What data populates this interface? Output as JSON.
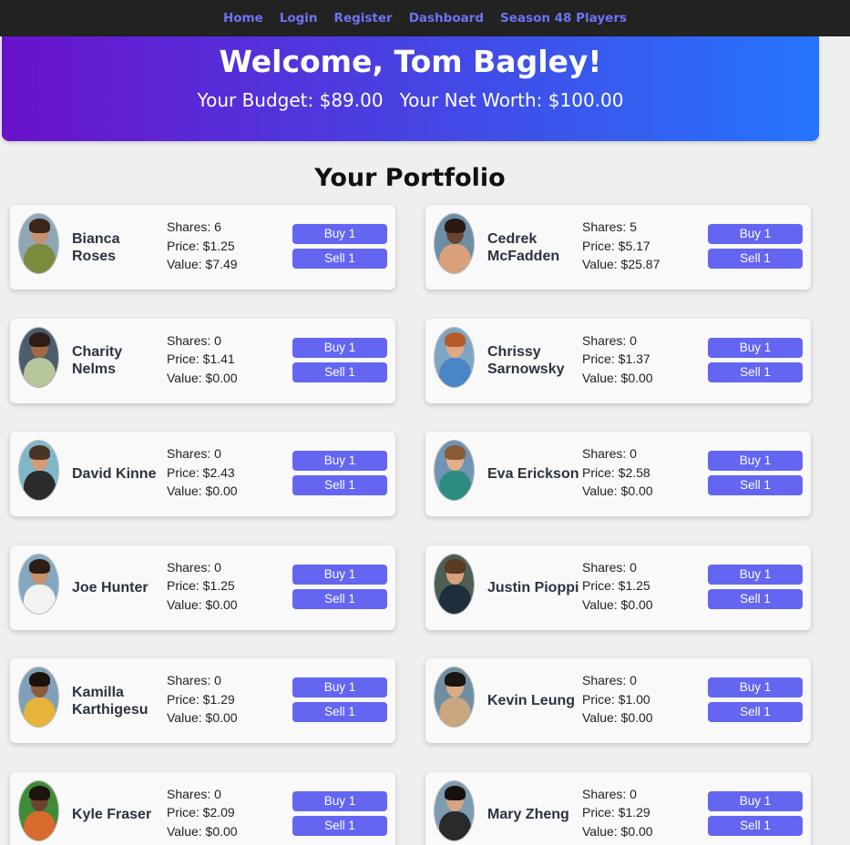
{
  "nav": {
    "items": [
      "Home",
      "Login",
      "Register",
      "Dashboard",
      "Season 48 Players"
    ]
  },
  "hero": {
    "welcome": "Welcome, Tom Bagley!",
    "budget": "Your Budget: $89.00",
    "net_worth": "Your Net Worth: $100.00"
  },
  "portfolio_title": "Your Portfolio",
  "buy_label": "Buy 1",
  "sell_label": "Sell 1",
  "players": [
    {
      "name": "Bianca Roses",
      "shares": "Shares: 6",
      "price": "Price: $1.25",
      "value": "Value: $7.49",
      "photo": {
        "bg": "#8ea7b5",
        "skin": "#c69272",
        "hair": "#3b2618",
        "shirt": "#7b8d3c"
      }
    },
    {
      "name": "Cedrek McFadden",
      "shares": "Shares: 5",
      "price": "Price: $5.17",
      "value": "Value: $25.87",
      "photo": {
        "bg": "#6c8fa8",
        "skin": "#6b4530",
        "hair": "#2a1a12",
        "shirt": "#d9a07c"
      }
    },
    {
      "name": "Charity Nelms",
      "shares": "Shares: 0",
      "price": "Price: $1.41",
      "value": "Value: $0.00",
      "photo": {
        "bg": "#4d5d6e",
        "skin": "#a36a47",
        "hair": "#2d1d14",
        "shirt": "#b7c59c"
      }
    },
    {
      "name": "Chrissy Sarnowsky",
      "shares": "Shares: 0",
      "price": "Price: $1.37",
      "value": "Value: $0.00",
      "photo": {
        "bg": "#7ea6c3",
        "skin": "#e0a884",
        "hair": "#b55a2a",
        "shirt": "#4a86c5"
      }
    },
    {
      "name": "David Kinne",
      "shares": "Shares: 0",
      "price": "Price: $2.43",
      "value": "Value: $0.00",
      "photo": {
        "bg": "#7fb7c9",
        "skin": "#d39b78",
        "hair": "#4a3424",
        "shirt": "#2b2b2b"
      }
    },
    {
      "name": "Eva Erickson",
      "shares": "Shares: 0",
      "price": "Price: $2.58",
      "value": "Value: $0.00",
      "photo": {
        "bg": "#6f94b5",
        "skin": "#e2ae8c",
        "hair": "#8a5a34",
        "shirt": "#2c8c80"
      }
    },
    {
      "name": "Joe Hunter",
      "shares": "Shares: 0",
      "price": "Price: $1.25",
      "value": "Value: $0.00",
      "photo": {
        "bg": "#84a8c0",
        "skin": "#c9906c",
        "hair": "#2e1f15",
        "shirt": "#f2f2f2"
      }
    },
    {
      "name": "Justin Pioppi",
      "shares": "Shares: 0",
      "price": "Price: $1.25",
      "value": "Value: $0.00",
      "photo": {
        "bg": "#4d5f55",
        "skin": "#d8a27c",
        "hair": "#5a3a22",
        "shirt": "#1f2e3d"
      }
    },
    {
      "name": "Kamilla Karthigesu",
      "shares": "Shares: 0",
      "price": "Price: $1.29",
      "value": "Value: $0.00",
      "photo": {
        "bg": "#7fa0b8",
        "skin": "#8c5a3c",
        "hair": "#1c120c",
        "shirt": "#e7b33a"
      }
    },
    {
      "name": "Kevin Leung",
      "shares": "Shares: 0",
      "price": "Price: $1.00",
      "value": "Value: $0.00",
      "photo": {
        "bg": "#6e8fa3",
        "skin": "#d9ac86",
        "hair": "#1b1410",
        "shirt": "#c9a680"
      }
    },
    {
      "name": "Kyle Fraser",
      "shares": "Shares: 0",
      "price": "Price: $2.09",
      "value": "Value: $0.00",
      "photo": {
        "bg": "#3f8b3a",
        "skin": "#6b4330",
        "hair": "#1e1510",
        "shirt": "#d86a2e"
      }
    },
    {
      "name": "Mary Zheng",
      "shares": "Shares: 0",
      "price": "Price: $1.29",
      "value": "Value: $0.00",
      "photo": {
        "bg": "#7c9cb1",
        "skin": "#d6a482",
        "hair": "#17110d",
        "shirt": "#2a2a2a"
      }
    }
  ],
  "colors": {
    "accent": "#6466f1",
    "hero_gradient_start": "#6a11cb",
    "hero_gradient_end": "#2575fc",
    "nav_background": "#222222"
  }
}
